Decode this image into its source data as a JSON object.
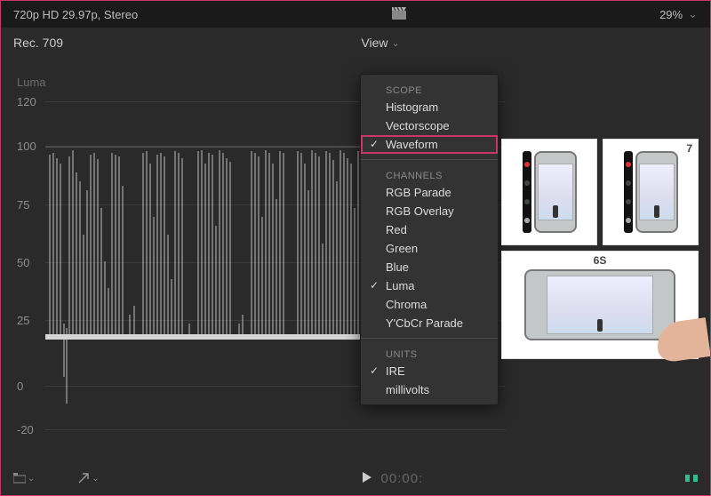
{
  "topbar": {
    "format": "720p HD 29.97p, Stereo",
    "zoom": "29%"
  },
  "secondbar": {
    "color_space": "Rec. 709",
    "view_label": "View"
  },
  "scope": {
    "label": "Luma",
    "axis_ticks": [
      "120",
      "100",
      "75",
      "50",
      "25",
      "0",
      "-20"
    ]
  },
  "menu": {
    "sections": {
      "scope": {
        "header": "SCOPE",
        "items": [
          {
            "label": "Histogram",
            "checked": false,
            "highlight": false
          },
          {
            "label": "Vectorscope",
            "checked": false,
            "highlight": false
          },
          {
            "label": "Waveform",
            "checked": true,
            "highlight": true
          }
        ]
      },
      "channels": {
        "header": "CHANNELS",
        "items": [
          {
            "label": "RGB Parade",
            "checked": false
          },
          {
            "label": "RGB Overlay",
            "checked": false
          },
          {
            "label": "Red",
            "checked": false
          },
          {
            "label": "Green",
            "checked": false
          },
          {
            "label": "Blue",
            "checked": false
          },
          {
            "label": "Luma",
            "checked": true
          },
          {
            "label": "Chroma",
            "checked": false
          },
          {
            "label": "Y'CbCr Parade",
            "checked": false
          }
        ]
      },
      "units": {
        "header": "UNITS",
        "items": [
          {
            "label": "IRE",
            "checked": true
          },
          {
            "label": "millivolts",
            "checked": false
          }
        ]
      }
    }
  },
  "thumbs": {
    "a": "",
    "b": "7",
    "c": "6S"
  },
  "transport": {
    "timecode": "00:00:"
  }
}
